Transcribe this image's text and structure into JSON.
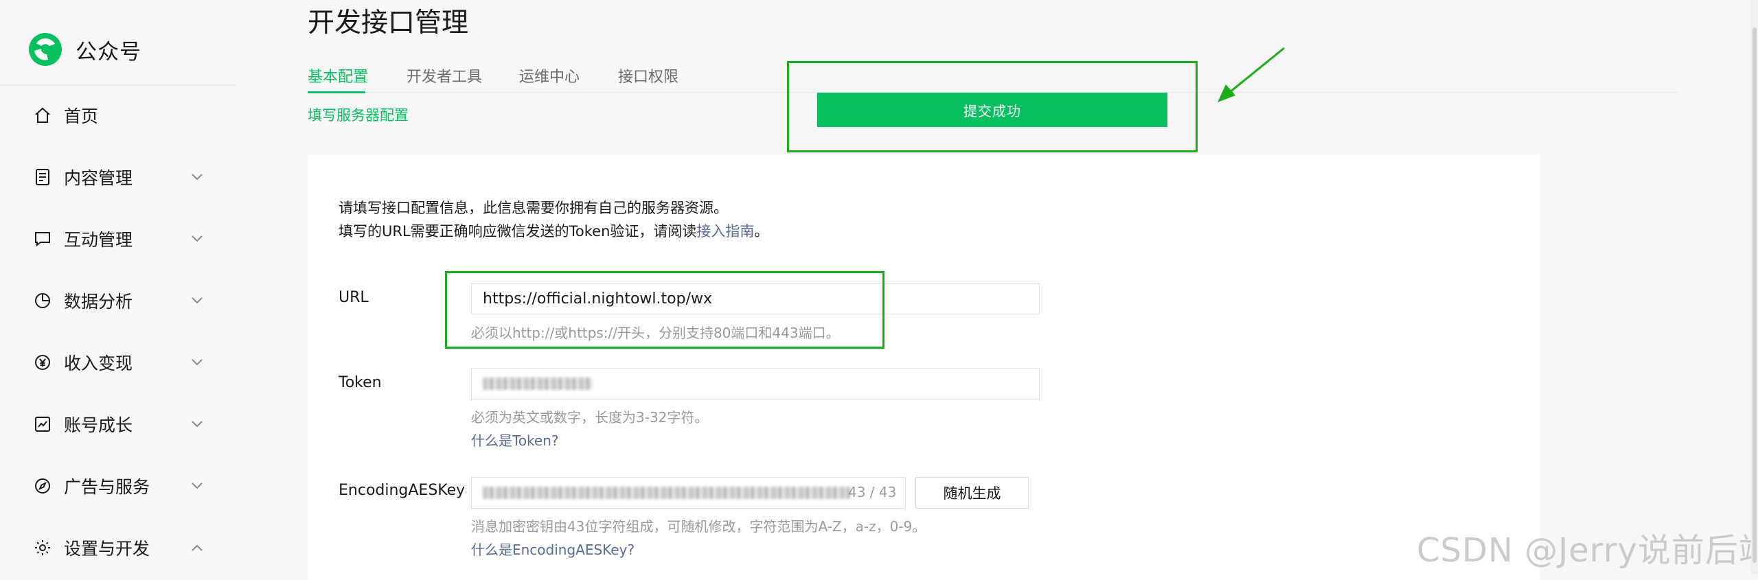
{
  "app": {
    "name": "公众号"
  },
  "sidebar": {
    "items": [
      {
        "label": "首页",
        "icon": "home-icon"
      },
      {
        "label": "内容管理",
        "icon": "document-icon"
      },
      {
        "label": "互动管理",
        "icon": "chat-icon"
      },
      {
        "label": "数据分析",
        "icon": "pie-chart-icon"
      },
      {
        "label": "收入变现",
        "icon": "yen-icon"
      },
      {
        "label": "账号成长",
        "icon": "trend-chart-icon"
      },
      {
        "label": "广告与服务",
        "icon": "compass-icon"
      },
      {
        "label": "设置与开发",
        "icon": "gear-icon"
      }
    ]
  },
  "page": {
    "title": "开发接口管理",
    "tabs": [
      {
        "label": "基本配置",
        "active": true
      },
      {
        "label": "开发者工具",
        "active": false
      },
      {
        "label": "运维中心",
        "active": false
      },
      {
        "label": "接口权限",
        "active": false
      }
    ],
    "sublink": "填写服务器配置",
    "success_button": "提交成功"
  },
  "form": {
    "intro_line1": "请填写接口配置信息，此信息需要你拥有自己的服务器资源。",
    "intro_line2_prefix": "填写的URL需要正确响应微信发送的Token验证，请阅读",
    "intro_link": "接入指南",
    "intro_line2_suffix": "。",
    "url": {
      "label": "URL",
      "value": "https://official.nightowl.top/wx",
      "tip": "必须以http://或https://开头，分别支持80端口和443端口。"
    },
    "token": {
      "label": "Token",
      "tip": "必须为英文或数字，长度为3-32字符。",
      "help": "什么是Token?"
    },
    "aeskey": {
      "label": "EncodingAESKey",
      "counter": "43 / 43",
      "random_button": "随机生成",
      "tip": "消息加密密钥由43位字符组成，可随机修改，字符范围为A-Z，a-z，0-9。",
      "help": "什么是EncodingAESKey?"
    }
  },
  "watermark": "CSDN @Jerry说前后端",
  "colors": {
    "accent": "#07c160",
    "link": "#576b95",
    "highlight": "#1aad19"
  }
}
